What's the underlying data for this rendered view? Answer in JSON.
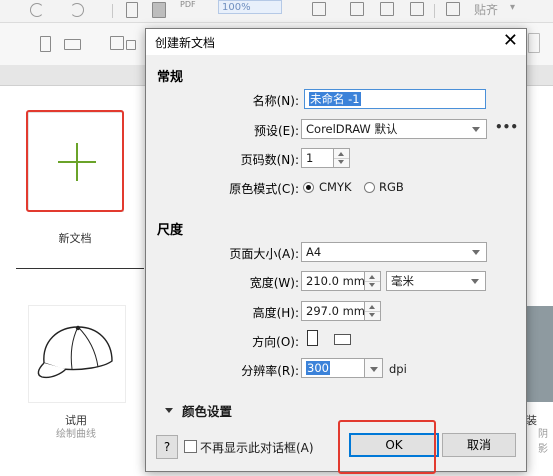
{
  "toolbar": {
    "zoom_value": "100%",
    "snap_label": "贴齐",
    "pdf_label": "PDF"
  },
  "welcome": {
    "new_doc_label": "新文档",
    "template_label": "试用",
    "template_sub": "绘制曲线",
    "right_label": "装",
    "right_sub": "阴影"
  },
  "dialog": {
    "title": "创建新文档",
    "general_header": "常规",
    "name_label": "名称(N):",
    "name_value": "未命名 -1",
    "preset_label": "预设(E):",
    "preset_value": "CorelDRAW 默认",
    "more_label": "•••",
    "pages_label": "页码数(N):",
    "pages_value": "1",
    "color_mode_label": "原色模式(C):",
    "color_mode_cmyk": "CMYK",
    "color_mode_rgb": "RGB",
    "color_mode_selected": "CMYK",
    "dimension_header": "尺度",
    "page_size_label": "页面大小(A):",
    "page_size_value": "A4",
    "width_label": "宽度(W):",
    "width_value": "210.0 mm",
    "unit_value": "毫米",
    "height_label": "高度(H):",
    "height_value": "297.0 mm",
    "orientation_label": "方向(O):",
    "resolution_label": "分辨率(R):",
    "resolution_value": "300",
    "resolution_unit": "dpi",
    "color_settings_label": "颜色设置",
    "help_label": "?",
    "dont_show_label": "不再显示此对话框(A)",
    "ok_label": "OK",
    "cancel_label": "取消"
  },
  "colors": {
    "highlight_red": "#e23a2f",
    "plus_green": "#6aa329",
    "selection_blue": "#3b82d9"
  }
}
